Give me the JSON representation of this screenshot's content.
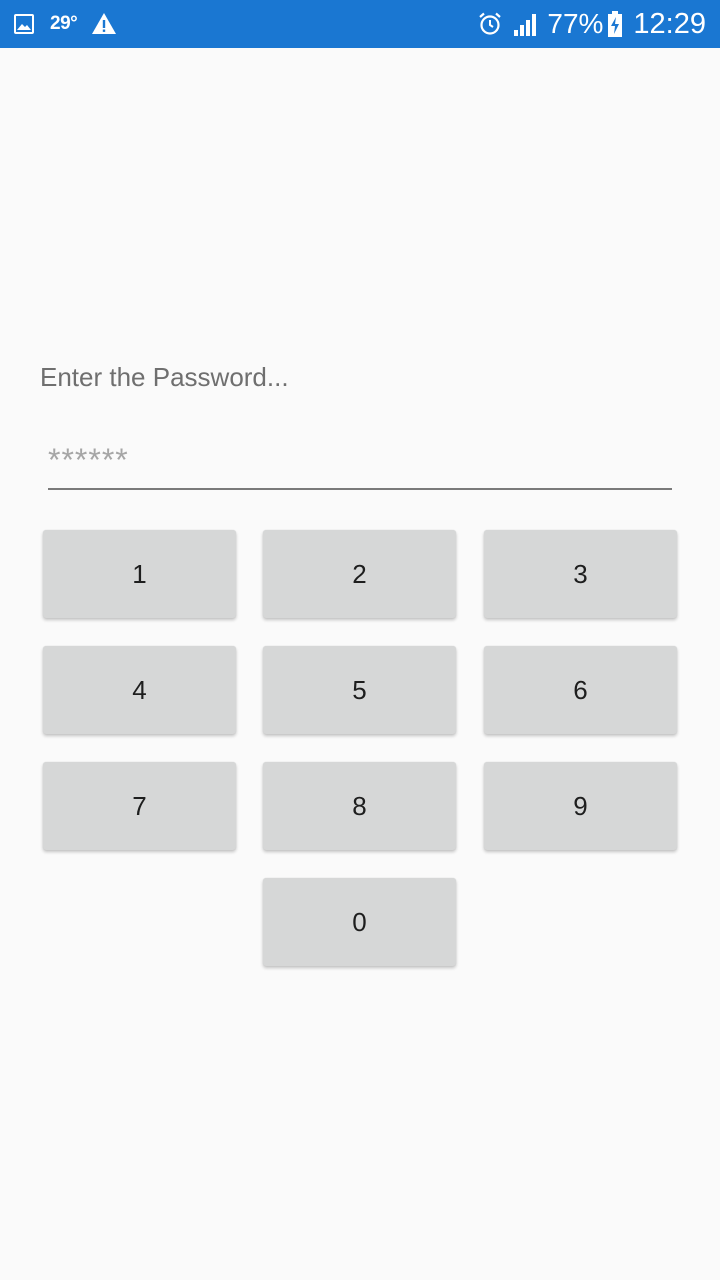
{
  "status_bar": {
    "temperature": "29°",
    "battery_percent": "77%",
    "time": "12:29",
    "icons": [
      "gallery-icon",
      "warning-icon",
      "alarm-icon",
      "signal-icon",
      "battery-charging-icon"
    ]
  },
  "prompt": "Enter the Password...",
  "password_field": {
    "placeholder": "******"
  },
  "keypad": {
    "keys": [
      "1",
      "2",
      "3",
      "4",
      "5",
      "6",
      "7",
      "8",
      "9",
      "0"
    ]
  },
  "colors": {
    "status_bar": "#1a77d2",
    "background": "#fafafa",
    "key_background": "#d6d7d7"
  }
}
